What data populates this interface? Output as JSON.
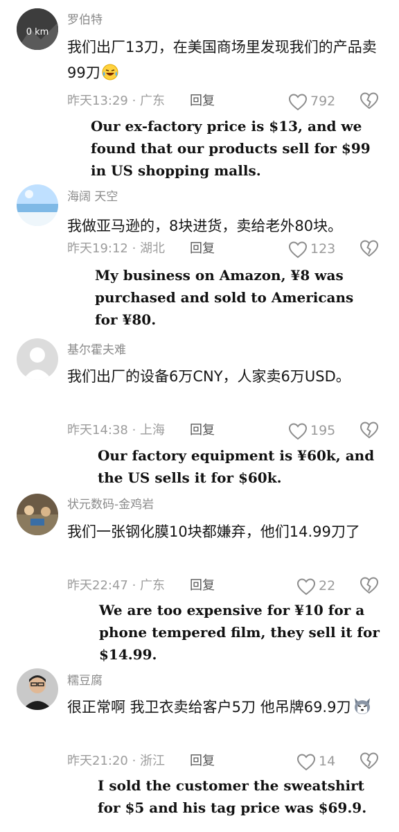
{
  "comments": [
    {
      "username": "罗伯特",
      "avatar_text": "0 km",
      "text": "我们出厂13刀，在美国商场里发现我们的产品卖99刀",
      "emoji": "laughing-tears-emoji",
      "meta": "昨天13:29 · 广东",
      "reply_label": "回复",
      "likes": "792",
      "translation": "Our ex-factory price is $13, and we found that our products sell for $99 in US shopping malls."
    },
    {
      "username": "海阔 天空",
      "avatar_text": "",
      "text": "我做亚马逊的，8块进货，卖给老外80块。",
      "emoji": "",
      "meta": "昨天19:12 · 湖北",
      "reply_label": "回复",
      "likes": "123",
      "translation": "My business on Amazon, ¥8 was purchased and sold to Americans for ¥80."
    },
    {
      "username": "基尔霍夫难",
      "avatar_text": "",
      "text": "我们出厂的设备6万CNY，人家卖6万USD。",
      "emoji": "",
      "meta": "昨天14:38 · 上海",
      "reply_label": "回复",
      "likes": "195",
      "translation": "Our factory equipment is ¥60k, and the US sells it for $60k."
    },
    {
      "username": "状元数码-金鸡岩",
      "avatar_text": "",
      "text": "我们一张钢化膜10块都嫌弃，他们14.99刀了",
      "emoji": "",
      "meta": "昨天22:47 · 广东",
      "reply_label": "回复",
      "likes": "22",
      "translation": "We are too expensive for ¥10 for a phone tempered film, they sell it for $14.99."
    },
    {
      "username": "糯豆腐",
      "avatar_text": "",
      "text": "很正常啊  我卫衣卖给客户5刀  他吊牌69.9刀",
      "emoji": "husky-dog-emoji",
      "meta": "昨天21:20 · 浙江",
      "reply_label": "回复",
      "likes": "14",
      "translation": "I sold the customer the sweatshirt for $5 and his tag price was $69.9."
    }
  ]
}
